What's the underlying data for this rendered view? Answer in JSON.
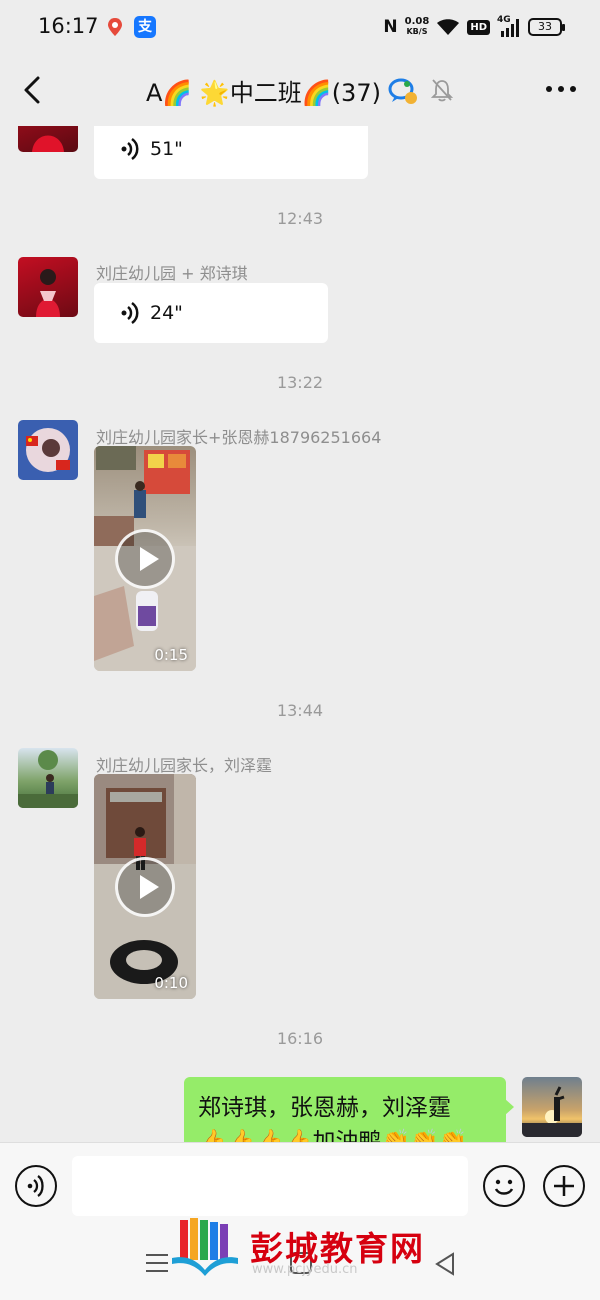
{
  "status_bar": {
    "time": "16:17",
    "nfc": "N",
    "speed_value": "0.08",
    "speed_unit": "KB/S",
    "hd": "HD",
    "network": "4G",
    "battery": "33"
  },
  "header": {
    "title": "A🌈 🌟中二班🌈(37)"
  },
  "messages": [
    {
      "type": "voice",
      "duration": "51\""
    },
    {
      "type": "time",
      "text": "12:43"
    },
    {
      "type": "voice",
      "sender": "刘庄幼儿园 + 郑诗琪",
      "duration": "24\""
    },
    {
      "type": "time",
      "text": "13:22"
    },
    {
      "type": "video",
      "sender": "刘庄幼儿园家长+张恩赫18796251664",
      "duration": "0:15"
    },
    {
      "type": "time",
      "text": "13:44"
    },
    {
      "type": "video",
      "sender": "刘庄幼儿园家长，刘泽霆",
      "duration": "0:10"
    },
    {
      "type": "time",
      "text": "16:16"
    },
    {
      "type": "text",
      "from": "me",
      "line1": "郑诗琪，张恩赫，刘泽霆",
      "line2": "👍👍👍👍加油鸭👏👏👏"
    }
  ],
  "input": {
    "value": ""
  },
  "watermark": {
    "text": "彭城教育网",
    "url": "www.pcjyedu.cn"
  },
  "colors": {
    "my_bubble": "#95ec69",
    "background": "#ededed",
    "bubble": "#ffffff",
    "watermark": "#d6000f"
  }
}
